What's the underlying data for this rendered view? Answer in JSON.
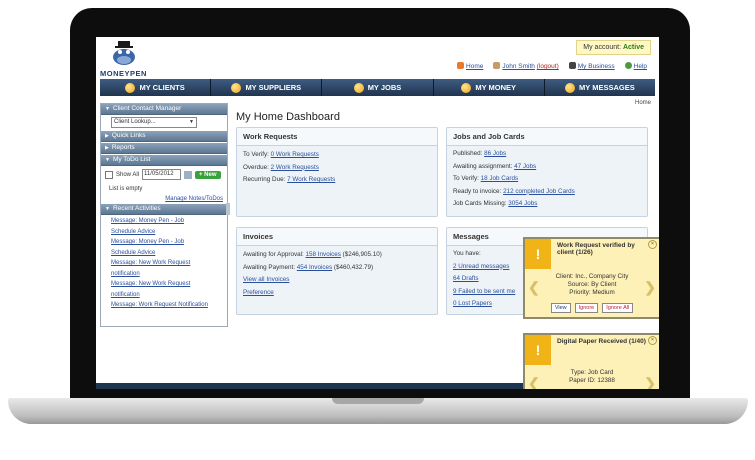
{
  "app": {
    "logo_text": "MONEYPEN"
  },
  "account": {
    "label": "My account:",
    "status": "Active"
  },
  "top_links": {
    "home": "Home",
    "user": "John Smith",
    "logout": "(logout)",
    "business": "My Business",
    "help": "Help"
  },
  "nav": [
    "MY CLIENTS",
    "MY SUPPLIERS",
    "MY JOBS",
    "MY MONEY",
    "MY MESSAGES"
  ],
  "breadcrumb": "Home",
  "sidebar": {
    "client_contact_manager": "Client Contact Manager",
    "client_lookup": "Client Lookup...",
    "quick_links": "Quick Links",
    "reports": "Reports",
    "todo_list": "My ToDo List",
    "show_all": "Show All",
    "date": "11/05/2012",
    "new_button": "+ New",
    "empty": "List is empty",
    "manage": "Manage Notes/ToDos",
    "recent_activities": "Recent Activities",
    "activities": [
      "Message: Money Pen - Job",
      "Schedule Advice",
      "Message: Money Pen - Job",
      "Schedule Advice",
      "Message: New Work Request",
      "notification",
      "Message: New Work Request",
      "notification",
      "Message: Work Request Notification"
    ]
  },
  "page_title": "My Home Dashboard",
  "work_requests": {
    "title": "Work Requests",
    "rows": [
      {
        "label": "To Verify:",
        "link": "0 Work Requests"
      },
      {
        "label": "Overdue:",
        "link": "2 Work Requests"
      },
      {
        "label": "Recurring Due:",
        "link": "7 Work Requests"
      }
    ]
  },
  "jobs": {
    "title": "Jobs and Job Cards",
    "rows": [
      {
        "label": "Published:",
        "link": "86 Jobs"
      },
      {
        "label": "Awaiting assignment:",
        "link": "47 Jobs"
      },
      {
        "label": "To Verify:",
        "link": "18 Job Cards"
      },
      {
        "label": "Ready to invoice:",
        "link": "212 completed Job Cards"
      },
      {
        "label": "Job Cards Missing:",
        "link": "3054 Jobs"
      }
    ]
  },
  "invoices": {
    "title": "Invoices",
    "row1_label": "Awaiting for Approval:",
    "row1_link": "158 Invoices",
    "row1_amount": "($246,905.10)",
    "row2_label": "Awaiting Payment:",
    "row2_link": "454 Invoices",
    "row2_amount": "($460,432.79)",
    "view_all": "View all Invoices",
    "preference": "Preference"
  },
  "messages": {
    "title": "Messages",
    "you_have": "You have:",
    "links": [
      "2 Unread messages",
      "64 Drafts",
      "9 Failed to be sent me",
      "0 Lost Papers"
    ]
  },
  "notifications": [
    {
      "title": "Work Request verified by client",
      "count": "(1/26)",
      "client_label": "Client:",
      "client_value": "Inc., Company City",
      "source_label": "Source:",
      "source_value": "By Client",
      "priority_label": "Priority:",
      "priority_value": "Medium",
      "buttons": [
        "View",
        "Ignore",
        "Ignore All"
      ]
    },
    {
      "title": "Digital Paper Received",
      "count": "(1/40)",
      "type_label": "Type:",
      "type_value": "Job Card",
      "paper_label": "Paper ID:",
      "paper_value": "12388"
    }
  ]
}
